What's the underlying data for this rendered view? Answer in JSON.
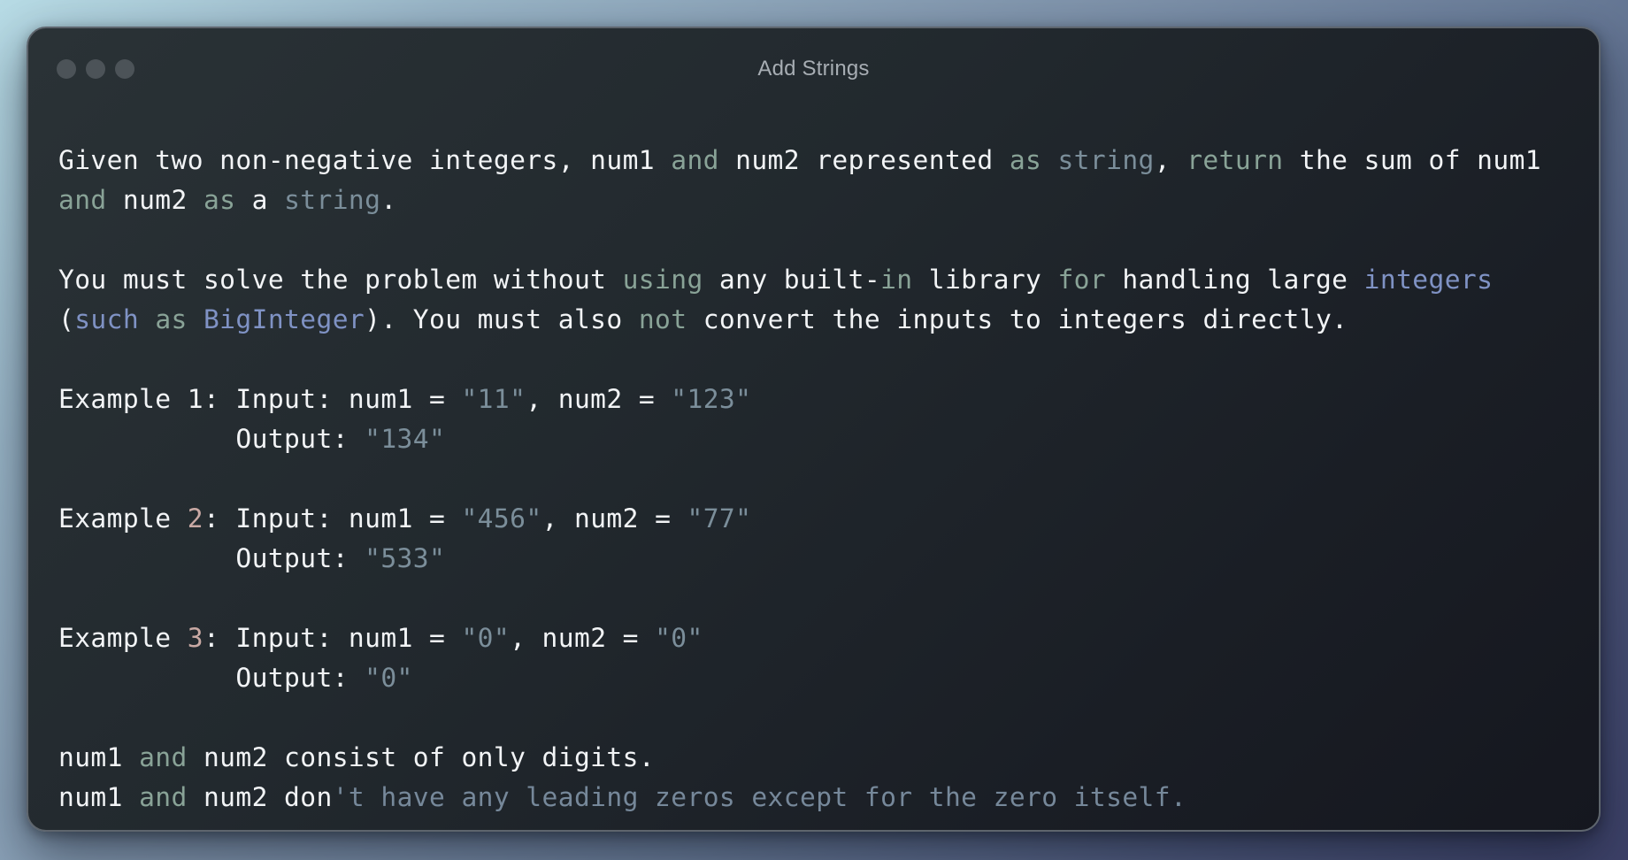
{
  "window": {
    "title": "Add Strings"
  },
  "colors": {
    "text": "#f2f4f6",
    "keyword": "#89a397",
    "string": "#7b8e9a",
    "number": "#c9a9a4",
    "class": "#7f92c4",
    "comment": "#76889a"
  },
  "lines": [
    [
      {
        "text": "Given two non-negative integers, num1 ",
        "style": "plain"
      },
      {
        "text": "and",
        "style": "kw"
      },
      {
        "text": " num2 represented ",
        "style": "plain"
      },
      {
        "text": "as",
        "style": "kw"
      },
      {
        "text": " ",
        "style": "plain"
      },
      {
        "text": "string",
        "style": "str"
      },
      {
        "text": ", ",
        "style": "plain"
      },
      {
        "text": "return",
        "style": "kw"
      },
      {
        "text": " the sum of num1",
        "style": "plain"
      }
    ],
    [
      {
        "text": "and",
        "style": "kw"
      },
      {
        "text": " num2 ",
        "style": "plain"
      },
      {
        "text": "as",
        "style": "kw"
      },
      {
        "text": " a ",
        "style": "plain"
      },
      {
        "text": "string",
        "style": "str"
      },
      {
        "text": ".",
        "style": "plain"
      }
    ],
    [],
    [
      {
        "text": "You must solve the problem without ",
        "style": "plain"
      },
      {
        "text": "using",
        "style": "kw"
      },
      {
        "text": " any built-",
        "style": "plain"
      },
      {
        "text": "in",
        "style": "kw"
      },
      {
        "text": " library ",
        "style": "plain"
      },
      {
        "text": "for",
        "style": "kw"
      },
      {
        "text": " handling large ",
        "style": "plain"
      },
      {
        "text": "integers",
        "style": "cls"
      }
    ],
    [
      {
        "text": "(",
        "style": "plain"
      },
      {
        "text": "such",
        "style": "cls"
      },
      {
        "text": " ",
        "style": "plain"
      },
      {
        "text": "as",
        "style": "kw"
      },
      {
        "text": " ",
        "style": "plain"
      },
      {
        "text": "BigInteger",
        "style": "cls"
      },
      {
        "text": "). You must also ",
        "style": "plain"
      },
      {
        "text": "not",
        "style": "kw"
      },
      {
        "text": " convert the inputs to integers directly.",
        "style": "plain"
      }
    ],
    [],
    [
      {
        "text": "Example 1: Input: num1 = ",
        "style": "plain"
      },
      {
        "text": "\"11\"",
        "style": "str"
      },
      {
        "text": ", num2 = ",
        "style": "plain"
      },
      {
        "text": "\"123\"",
        "style": "str"
      }
    ],
    [
      {
        "text": "           Output: ",
        "style": "plain"
      },
      {
        "text": "\"134\"",
        "style": "str"
      }
    ],
    [],
    [
      {
        "text": "Example ",
        "style": "plain"
      },
      {
        "text": "2",
        "style": "num"
      },
      {
        "text": ": Input: num1 = ",
        "style": "plain"
      },
      {
        "text": "\"456\"",
        "style": "str"
      },
      {
        "text": ", num2 = ",
        "style": "plain"
      },
      {
        "text": "\"77\"",
        "style": "str"
      }
    ],
    [
      {
        "text": "           Output: ",
        "style": "plain"
      },
      {
        "text": "\"533\"",
        "style": "str"
      }
    ],
    [],
    [
      {
        "text": "Example ",
        "style": "plain"
      },
      {
        "text": "3",
        "style": "num"
      },
      {
        "text": ": Input: num1 = ",
        "style": "plain"
      },
      {
        "text": "\"0\"",
        "style": "str"
      },
      {
        "text": ", num2 = ",
        "style": "plain"
      },
      {
        "text": "\"0\"",
        "style": "str"
      }
    ],
    [
      {
        "text": "           Output: ",
        "style": "plain"
      },
      {
        "text": "\"0\"",
        "style": "str"
      }
    ],
    [],
    [
      {
        "text": "num1 ",
        "style": "plain"
      },
      {
        "text": "and",
        "style": "kw"
      },
      {
        "text": " num2 consist of only digits.",
        "style": "plain"
      }
    ],
    [
      {
        "text": "num1 ",
        "style": "plain"
      },
      {
        "text": "and",
        "style": "kw"
      },
      {
        "text": " num2 don",
        "style": "plain"
      },
      {
        "text": "'t have any leading zeros except for the zero itself.",
        "style": "dim"
      }
    ]
  ]
}
